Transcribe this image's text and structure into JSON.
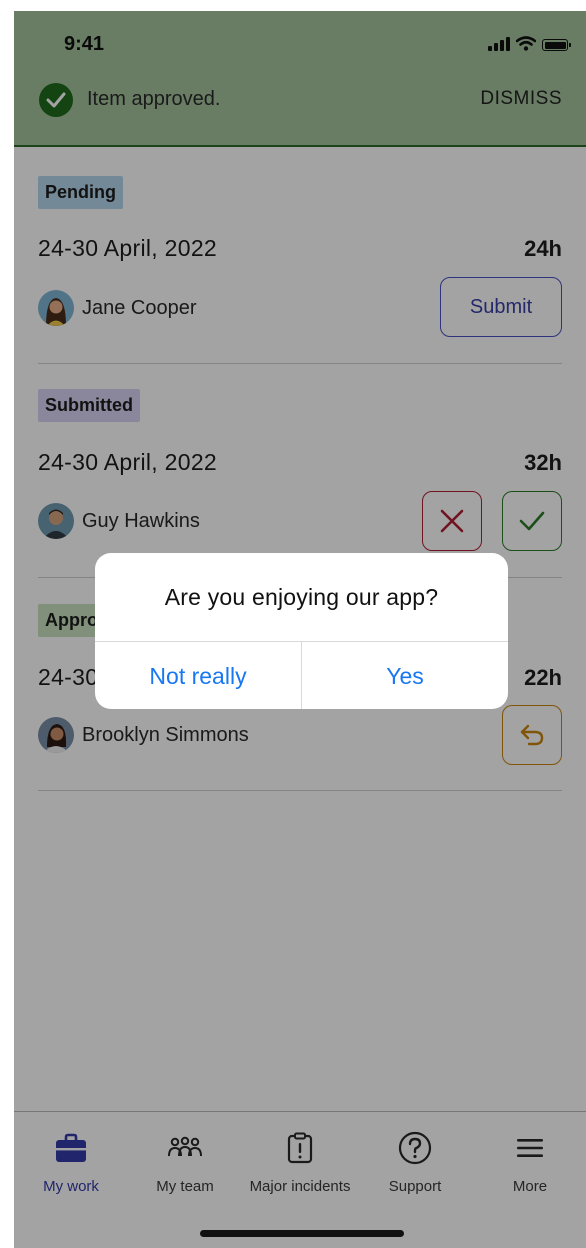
{
  "status_bar": {
    "time": "9:41"
  },
  "banner": {
    "message": "Item approved.",
    "dismiss_label": "DISMISS",
    "icon": "check-circle-icon"
  },
  "items": [
    {
      "status": "Pending",
      "status_color": "#b6d7ec",
      "period": "24-30 April, 2022",
      "hours": "24h",
      "name": "Jane Cooper",
      "action_label": "Submit"
    },
    {
      "status": "Submitted",
      "status_color": "#d8d2f4",
      "period": "24-30 April, 2022",
      "hours": "32h",
      "name": "Guy Hawkins",
      "reject_icon": "x-icon",
      "approve_icon": "check-icon"
    },
    {
      "status": "Approved",
      "status_color": "#c8e2bf",
      "period": "24-30 April, 2022",
      "hours": "22h",
      "name": "Brooklyn Simmons",
      "undo_icon": "undo-icon"
    }
  ],
  "dialog": {
    "title": "Are you enjoying our app?",
    "negative_label": "Not really",
    "positive_label": "Yes"
  },
  "tabs": [
    {
      "label": "My work",
      "icon": "briefcase-icon",
      "active": true
    },
    {
      "label": "My team",
      "icon": "team-icon",
      "active": false
    },
    {
      "label": "Major incidents",
      "icon": "clipboard-alert-icon",
      "active": false
    },
    {
      "label": "Support",
      "icon": "help-circle-icon",
      "active": false
    },
    {
      "label": "More",
      "icon": "menu-icon",
      "active": false
    }
  ],
  "colors": {
    "accent": "#343aa8",
    "banner": "#a5c49f",
    "reject": "#b02035",
    "approve": "#2c7a2a",
    "undo": "#c8860f",
    "dialog_action": "#1877f2"
  }
}
